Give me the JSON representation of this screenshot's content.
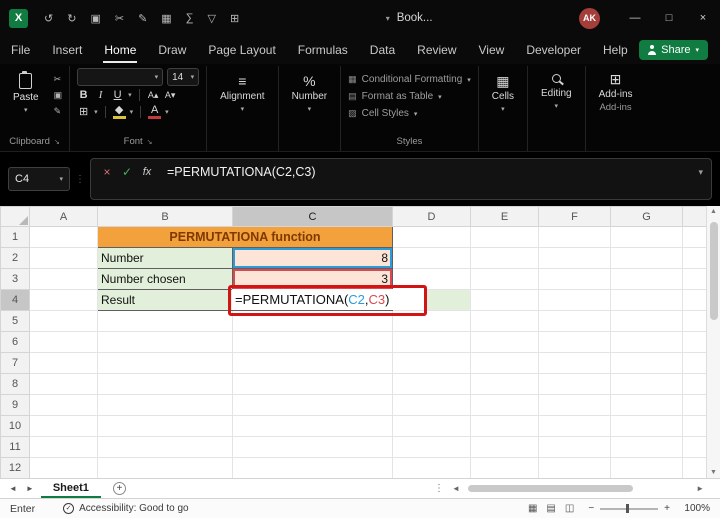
{
  "colors": {
    "accent-green": "#107C41",
    "title-orange": "#F2A13C",
    "title-text": "#7E3A00",
    "light-green": "#E2EFDA",
    "peach": "#FCE4D6",
    "ref-blue": "#2E9BD9",
    "ref-red": "#D9494F",
    "annotation-red": "#D21414",
    "avatar-red": "#A33E3A"
  },
  "icons": {
    "chevron": "▾",
    "launcher": "↘"
  },
  "title_bar": {
    "logo_letter": "X",
    "quick_access": [
      {
        "name": "undo-icon",
        "glyph": "↺"
      },
      {
        "name": "redo-icon",
        "glyph": "↻"
      },
      {
        "name": "clipboard-icon",
        "glyph": "▣"
      },
      {
        "name": "cut-icon",
        "glyph": "✂"
      },
      {
        "name": "format-painter-icon",
        "glyph": "✎"
      },
      {
        "name": "table-icon",
        "glyph": "▦"
      },
      {
        "name": "autosum-icon",
        "glyph": "∑"
      },
      {
        "name": "filter-icon",
        "glyph": "▽"
      },
      {
        "name": "grid-icon",
        "glyph": "⊞"
      }
    ],
    "document_name": "Book...",
    "avatar_initials": "AK",
    "window": {
      "minimize": "—",
      "maximize": "□",
      "close": "×"
    }
  },
  "menu": {
    "tabs": [
      "File",
      "Insert",
      "Home",
      "Draw",
      "Page Layout",
      "Formulas",
      "Data",
      "Review",
      "View",
      "Developer",
      "Help"
    ],
    "active_tab": "Home",
    "share_label": "Share"
  },
  "ribbon": {
    "paste_label": "Paste",
    "clipboard_group": "Clipboard",
    "cut_glyph": "✂",
    "copy_glyph": "▣",
    "painter_glyph": "✎",
    "font_size": "14",
    "bold": "B",
    "italic": "I",
    "underline": "U",
    "grow_font": "A▴",
    "shrink_font": "A▾",
    "borders_glyph": "⊞",
    "fill_glyph": "◆",
    "font_color_glyph": "A",
    "font_group": "Font",
    "alignment_glyph": "≡",
    "alignment_label": "Alignment",
    "number_glyph": "%",
    "number_label": "Number",
    "styles_items": [
      "Conditional Formatting",
      "Format as Table",
      "Cell Styles"
    ],
    "styles_group": "Styles",
    "cells_glyph": "▦",
    "cells_label": "Cells",
    "editing_label": "Editing",
    "addins_glyph": "⊞",
    "addins_label": "Add-ins",
    "addins_group": "Add-ins"
  },
  "formula_bar": {
    "name_box": "C4",
    "cancel": "×",
    "enter": "✓",
    "fx": "fx"
  },
  "formula": {
    "prefix": "=PERMUTATIONA(",
    "ref1": "C2",
    "comma": ",",
    "ref2": "C3",
    "suffix": ")"
  },
  "grid": {
    "columns": [
      "A",
      "B",
      "C",
      "D",
      "E",
      "F",
      "G"
    ],
    "rows": [
      "1",
      "2",
      "3",
      "4",
      "5",
      "6",
      "7",
      "8",
      "9",
      "10",
      "11",
      "12"
    ],
    "selected_column": "C",
    "selected_row": "4",
    "cells": {
      "title": "PERMUTATIONA function",
      "b2": "Number",
      "c2": "8",
      "b3": "Number chosen",
      "c3": "3",
      "b4": "Result"
    }
  },
  "sheet_bar": {
    "prev": "◄",
    "next": "►",
    "tab": "Sheet1",
    "add": "+",
    "dots": "⋮",
    "hprev": "◄",
    "hnext": "►"
  },
  "status_bar": {
    "mode": "Enter",
    "acc_check": "✓",
    "accessibility": "Accessibility: Good to go",
    "view_icons": [
      {
        "name": "normal-view-icon",
        "glyph": "▦"
      },
      {
        "name": "page-layout-view-icon",
        "glyph": "▤"
      },
      {
        "name": "page-break-view-icon",
        "glyph": "◫"
      }
    ],
    "zoom_out": "−",
    "zoom_in": "+",
    "zoom": "100%"
  }
}
